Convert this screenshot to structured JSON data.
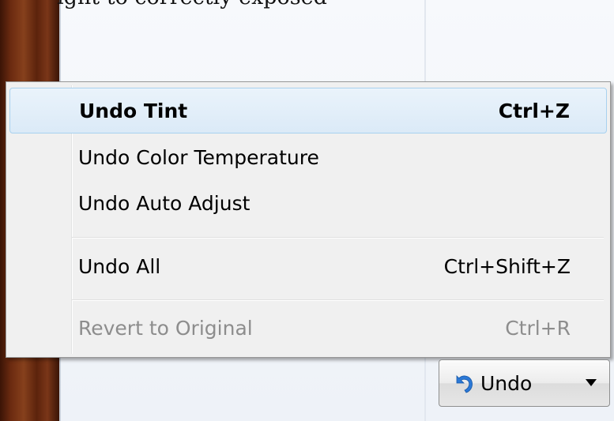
{
  "background": {
    "top_text": "ight to correctly exposed"
  },
  "menu": {
    "items": [
      {
        "label": "Undo Tint",
        "shortcut": "Ctrl+Z",
        "state": "highlighted"
      },
      {
        "label": "Undo Color Temperature",
        "shortcut": "",
        "state": "normal"
      },
      {
        "label": "Undo Auto Adjust",
        "shortcut": "",
        "state": "normal"
      },
      {
        "label": "Undo All",
        "shortcut": "Ctrl+Shift+Z",
        "state": "normal"
      },
      {
        "label": "Revert to Original",
        "shortcut": "Ctrl+R",
        "state": "disabled"
      }
    ]
  },
  "undo_button": {
    "label": "Undo",
    "icon": "undo-arrow-icon",
    "dropdown_icon": "chevron-down-icon"
  },
  "colors": {
    "highlight_border": "#a8d1ef",
    "highlight_fill": "#dbeaf7",
    "disabled_text": "#8d8d8d",
    "undo_icon_blue": "#2b78d6"
  }
}
